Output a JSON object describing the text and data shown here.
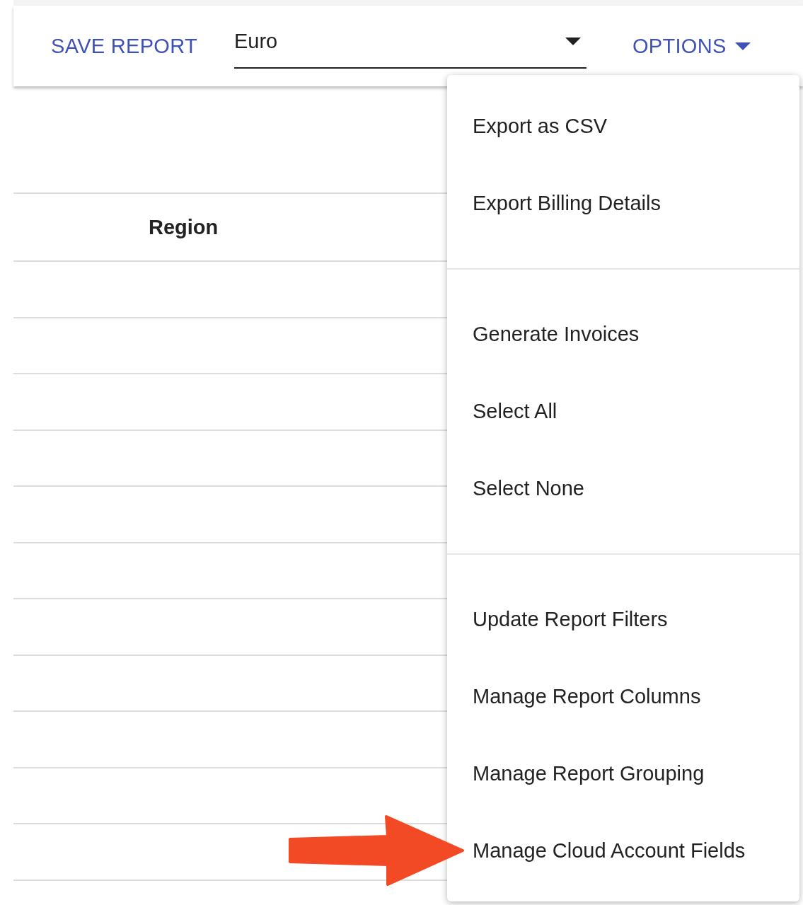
{
  "toolbar": {
    "save_button": "SAVE REPORT",
    "currency_select": {
      "value": "Euro"
    },
    "options_button": "OPTIONS"
  },
  "table": {
    "columns": [
      "Region"
    ]
  },
  "options_menu": {
    "sections": [
      {
        "items": [
          "Export as CSV",
          "Export Billing Details"
        ]
      },
      {
        "items": [
          "Generate Invoices",
          "Select All",
          "Select None"
        ]
      },
      {
        "items": [
          "Update Report Filters",
          "Manage Report Columns",
          "Manage Report Grouping",
          "Manage Cloud Account Fields"
        ]
      }
    ]
  },
  "annotation": {
    "kind": "arrow",
    "color": "#f24a25"
  }
}
